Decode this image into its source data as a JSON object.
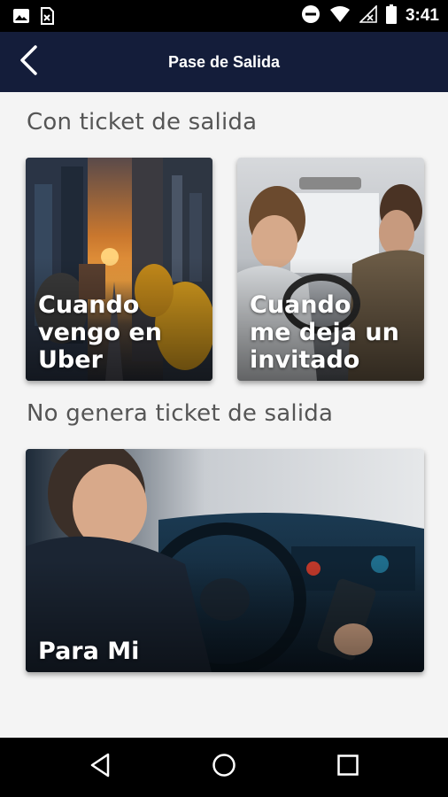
{
  "status_bar": {
    "time": "3:41",
    "icons": [
      "image-icon",
      "sim-icon",
      "dnd-icon",
      "wifi-icon",
      "no-signal-icon",
      "battery-icon"
    ]
  },
  "app_bar": {
    "title": "Pase de Salida",
    "back_icon": "back-chevron-icon",
    "background": "#141d3a"
  },
  "sections": [
    {
      "title": "Con ticket de salida",
      "cards": [
        {
          "label": "Cuando\nvengo en\nUber",
          "image": "city-traffic-sunset"
        },
        {
          "label": "Cuando\nme deja un\ninvitado",
          "image": "two-men-in-car"
        }
      ]
    },
    {
      "title": "No genera ticket de salida",
      "cards": [
        {
          "label": "Para Mi",
          "image": "man-driving-with-phone"
        }
      ]
    }
  ],
  "nav_bar": {
    "icons": [
      "back-triangle-icon",
      "home-circle-icon",
      "recents-square-icon"
    ]
  }
}
